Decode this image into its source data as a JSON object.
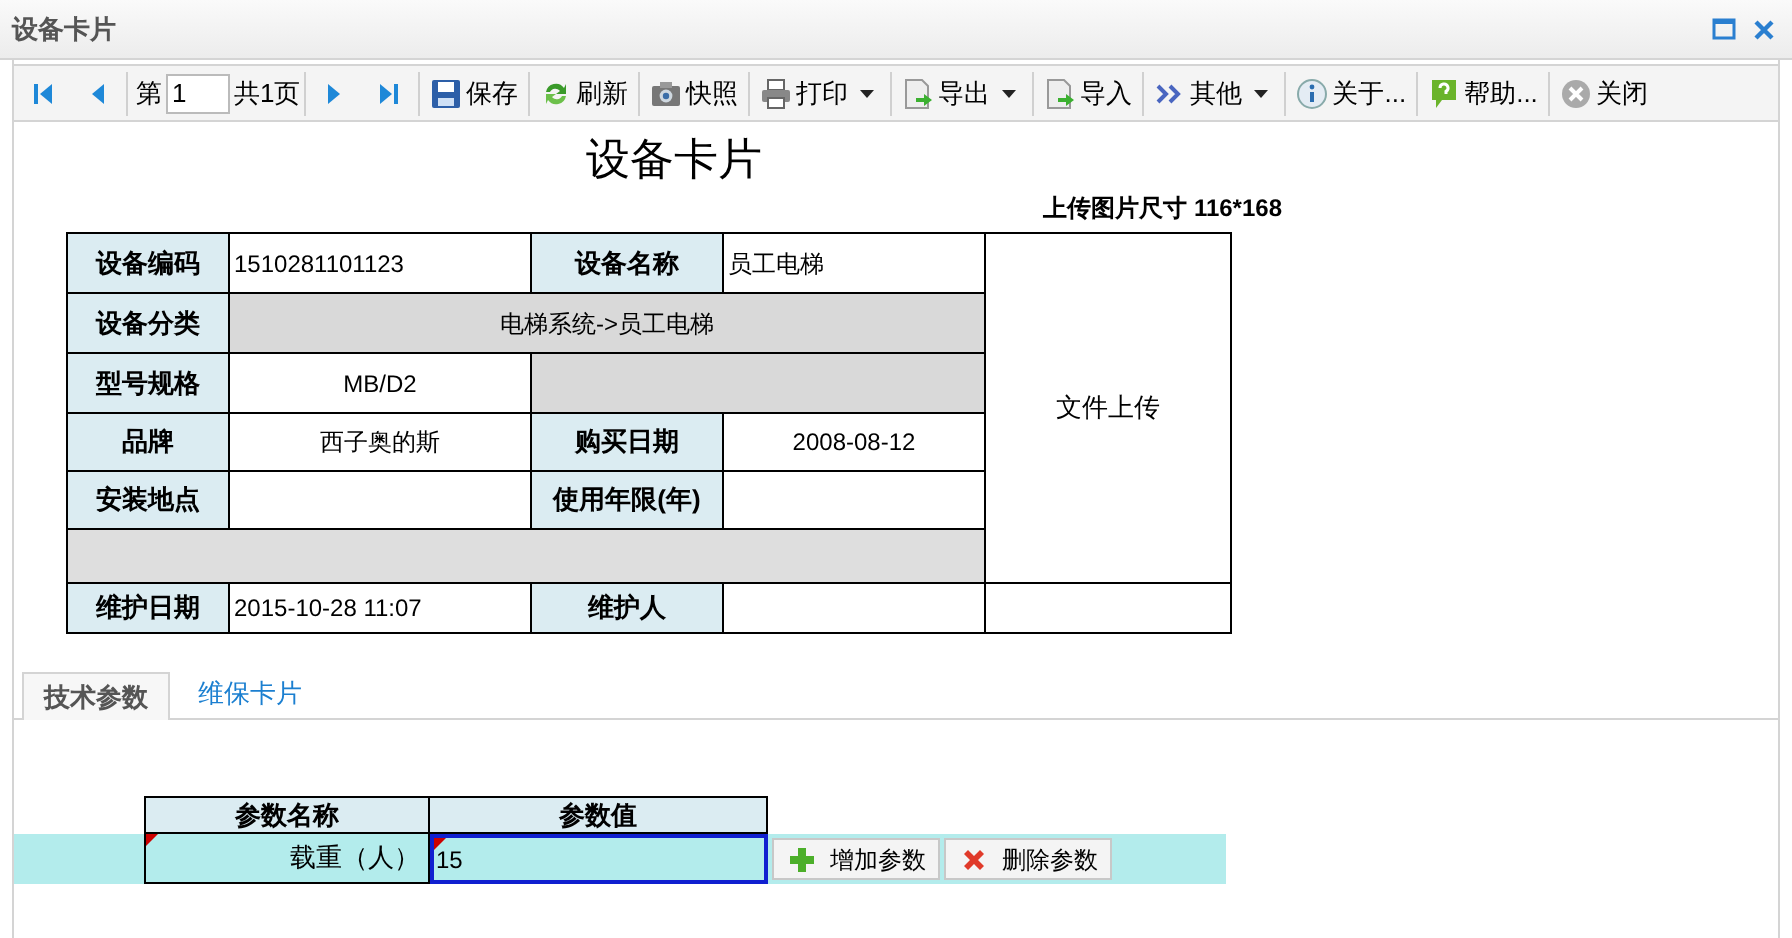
{
  "window": {
    "title": "设备卡片"
  },
  "toolbar": {
    "page": {
      "prefix": "第",
      "value": "1",
      "suffix": "共1页"
    },
    "buttons": [
      {
        "label": "保存",
        "kind": "save",
        "dropdown": false
      },
      {
        "label": "刷新",
        "kind": "refresh",
        "dropdown": false
      },
      {
        "label": "快照",
        "kind": "camera",
        "dropdown": false
      },
      {
        "label": "打印",
        "kind": "print",
        "dropdown": true
      },
      {
        "label": "导出",
        "kind": "export",
        "dropdown": true
      },
      {
        "label": "导入",
        "kind": "import",
        "dropdown": false
      },
      {
        "label": "其他",
        "kind": "more",
        "dropdown": true
      },
      {
        "label": "关于...",
        "kind": "info",
        "dropdown": false
      },
      {
        "label": "帮助...",
        "kind": "help",
        "dropdown": false
      },
      {
        "label": "关闭",
        "kind": "close",
        "dropdown": false
      }
    ]
  },
  "card": {
    "title": "设备卡片",
    "upload_note": "上传图片尺寸 116*168",
    "photo": "文件上传",
    "fields": [
      {
        "label": "设备编码",
        "value": "1510281101123"
      },
      {
        "label": "设备名称",
        "value": "员工电梯"
      },
      {
        "label": "设备分类",
        "value": "电梯系统->员工电梯"
      },
      {
        "label": "型号规格",
        "value": "MB/D2"
      },
      {
        "label": "品牌",
        "value": "西子奥的斯"
      },
      {
        "label": "购买日期",
        "value": "2008-08-12"
      },
      {
        "label": "安装地点"
      },
      {
        "label": "使用年限(年)"
      },
      {
        "label": "维护日期",
        "value": "2015-10-28 11:07"
      },
      {
        "label": "维护人"
      }
    ]
  },
  "tabs": [
    {
      "label": "技术参数",
      "selected": true
    },
    {
      "label": "维保卡片",
      "selected": false
    }
  ],
  "params": {
    "columns": [
      "参数名称",
      "参数值"
    ],
    "rows": [
      {
        "name": "载重（人）",
        "value": "15",
        "selected": true,
        "editing": true,
        "modified": true
      }
    ],
    "buttons": [
      {
        "label": "增加参数",
        "kind": "add"
      },
      {
        "label": "删除参数",
        "kind": "delete"
      }
    ]
  }
}
